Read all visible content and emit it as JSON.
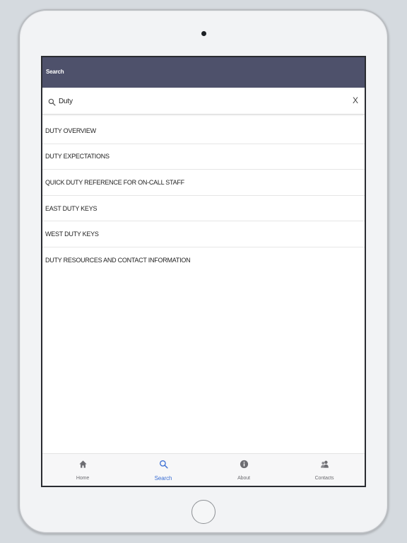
{
  "navbar": {
    "title": "Search"
  },
  "search": {
    "value": "Duty",
    "clear_label": "X",
    "icon": "search-icon"
  },
  "results": [
    "DUTY OVERVIEW",
    "DUTY EXPECTATIONS",
    "QUICK DUTY REFERENCE FOR ON-CALL STAFF",
    "EAST DUTY KEYS",
    "WEST DUTY KEYS",
    "DUTY RESOURCES AND CONTACT INFORMATION"
  ],
  "tabbar": {
    "active": "search",
    "tabs": [
      {
        "label": "Home",
        "icon": "home-icon"
      },
      {
        "label": "Search",
        "icon": "search-icon"
      },
      {
        "label": "About",
        "icon": "info-icon"
      },
      {
        "label": "Contacts",
        "icon": "contacts-icon"
      }
    ]
  },
  "colors": {
    "navbar": "#4e516b",
    "accent": "#3b6fd4",
    "tab_inactive": "#6d6d72",
    "device_bg": "#d5dadf"
  }
}
